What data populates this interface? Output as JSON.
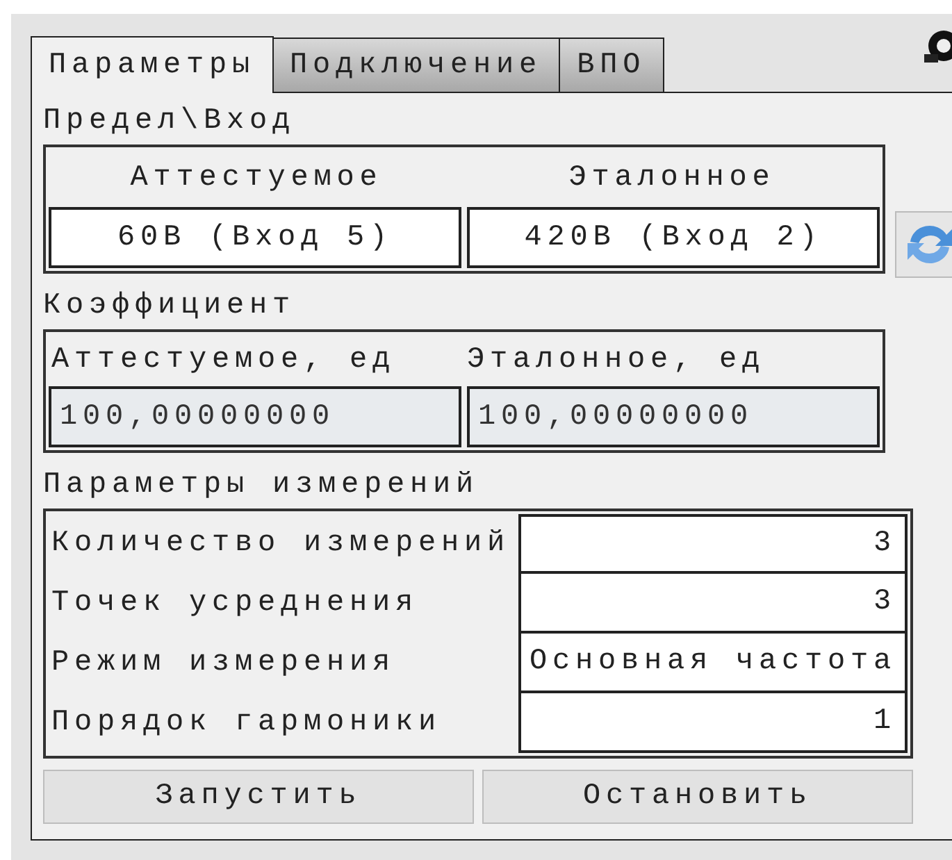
{
  "tabs": [
    {
      "label": "Параметры",
      "selected": true
    },
    {
      "label": "Подключение",
      "selected": false
    },
    {
      "label": "ВПО",
      "selected": false
    }
  ],
  "range": {
    "title": "Предел\\Вход",
    "columns": [
      {
        "header": "Аттестуемое",
        "value": "60В (Вход 5)"
      },
      {
        "header": "Эталонное",
        "value": "420В (Вход 2)"
      }
    ]
  },
  "coefficient": {
    "title": "Коэффициент",
    "columns": [
      {
        "header": "Аттестуемое, ед",
        "value": "100,00000000"
      },
      {
        "header": "Эталонное, ед",
        "value": "100,00000000"
      }
    ]
  },
  "measurement": {
    "title": "Параметры измерений",
    "rows": [
      {
        "label": "Количество измерений",
        "value": "3",
        "kind": "number"
      },
      {
        "label": "Точек усреднения",
        "value": "3",
        "kind": "number"
      },
      {
        "label": "Режим измерения",
        "value": "Основная частота",
        "kind": "choice"
      },
      {
        "label": "Порядок гармоники",
        "value": "1",
        "kind": "number"
      }
    ]
  },
  "buttons": [
    "Запустить",
    "Остановить"
  ]
}
